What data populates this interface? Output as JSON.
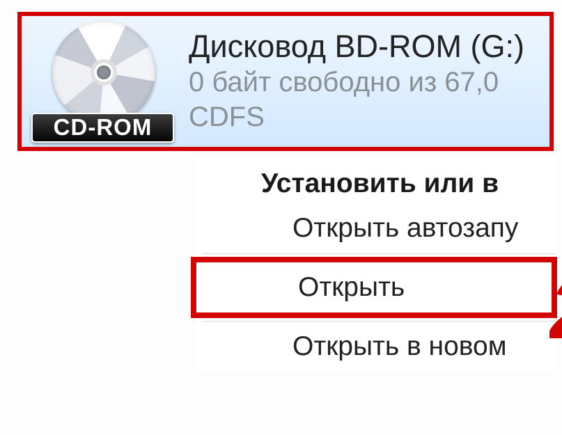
{
  "drive": {
    "title": "Дисковод BD-ROM (G:)",
    "subtitle": "0 байт свободно из 67,0",
    "fs": "CDFS",
    "plate": "CD-ROM"
  },
  "menu": {
    "section_title": "Установить или в",
    "item_autorun": "Открыть автозапу",
    "item_open": "Открыть",
    "item_open_new": "Открыть в новом"
  }
}
